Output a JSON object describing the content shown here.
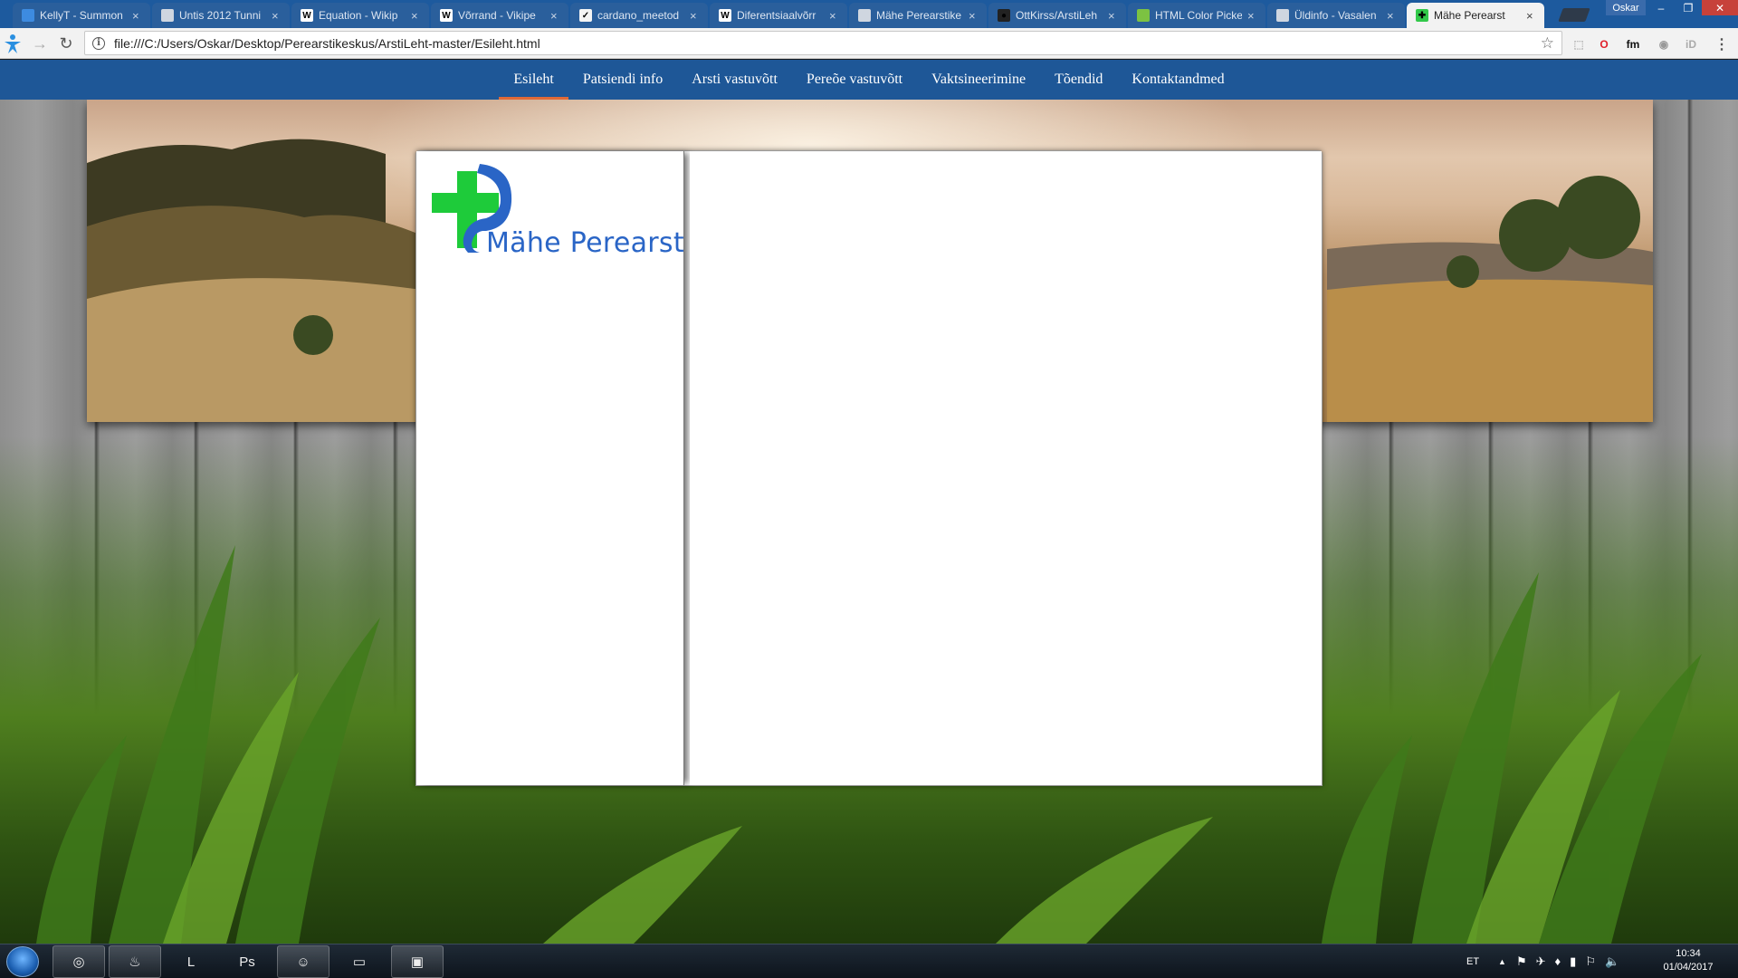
{
  "browser": {
    "tabs": [
      {
        "label": "KellyT - Summon",
        "icon_color": "#3d8be0",
        "icon_text": ""
      },
      {
        "label": "Untis 2012 Tunni",
        "icon_color": "#cfd6e0",
        "icon_text": ""
      },
      {
        "label": "Equation - Wikip",
        "icon_color": "#ffffff",
        "icon_text": "W"
      },
      {
        "label": "Võrrand - Vikipe",
        "icon_color": "#ffffff",
        "icon_text": "W"
      },
      {
        "label": "cardano_meetod",
        "icon_color": "#f4f4f4",
        "icon_text": "✓"
      },
      {
        "label": "Diferentsiaalvõrr",
        "icon_color": "#ffffff",
        "icon_text": "W"
      },
      {
        "label": "Mähe Perearstike",
        "icon_color": "#cfd6e0",
        "icon_text": ""
      },
      {
        "label": "OttKirss/ArstiLeh",
        "icon_color": "#222222",
        "icon_text": "●"
      },
      {
        "label": "HTML Color Picke",
        "icon_color": "#7cc242",
        "icon_text": ""
      },
      {
        "label": "Üldinfo - Vasalen",
        "icon_color": "#cfd6e0",
        "icon_text": ""
      },
      {
        "label": "Mähe Perearst",
        "icon_color": "#32c84a",
        "icon_text": "✚",
        "active": true
      }
    ],
    "tab_close": "×",
    "profile_name": "Oskar",
    "window_controls": {
      "minimize": "–",
      "restore": "❐",
      "close": "✕"
    },
    "nav": {
      "back": "←",
      "forward": "→",
      "reload": "↻"
    },
    "address": "file:///C:/Users/Oskar/Desktop/Perearstikeskus/ArstiLeht-master/Esileht.html",
    "info_glyph": "i",
    "bookmark_glyph": "☆",
    "extensions": [
      {
        "name": "extension-puzzle-icon",
        "glyph": "⬚",
        "color": "#bbbbbb"
      },
      {
        "name": "opera-icon",
        "glyph": "O",
        "color": "#e0202a"
      },
      {
        "name": "fm-icon",
        "glyph": "fm",
        "color": "#111111"
      },
      {
        "name": "ghost-icon",
        "glyph": "◉",
        "color": "#999999"
      },
      {
        "name": "id-icon",
        "glyph": "iD",
        "color": "#aaaaaa"
      }
    ],
    "menu_glyph": "⋮"
  },
  "site": {
    "nav_items": [
      "Esileht",
      "Patsiendi info",
      "Arsti vastuvõtt",
      "Pereõe vastuvõtt",
      "Vaktsineerimine",
      "Tõendid",
      "Kontaktandmed"
    ],
    "current_nav": 0,
    "accent": "#e06a37",
    "nav_bg": "#1e5797",
    "logo_text": "Mähe Perearst",
    "logo_green": "#1ecb3a",
    "logo_blue": "#2a65c6"
  },
  "taskbar": {
    "items": [
      {
        "name": "chrome-icon",
        "glyph": "◎",
        "pinned": true
      },
      {
        "name": "steam-icon",
        "glyph": "♨",
        "pinned": true
      },
      {
        "name": "league-icon",
        "glyph": "L",
        "pinned": false
      },
      {
        "name": "photoshop-icon",
        "glyph": "Ps",
        "pinned": false
      },
      {
        "name": "discord-icon",
        "glyph": "☺",
        "pinned": true
      },
      {
        "name": "file-explorer-icon",
        "glyph": "▭",
        "pinned": false
      },
      {
        "name": "control-panel-icon",
        "glyph": "▣",
        "pinned": true
      }
    ],
    "language": "ET",
    "tray_arrow": "▲",
    "time": "10:34",
    "date": "01/04/2017"
  }
}
